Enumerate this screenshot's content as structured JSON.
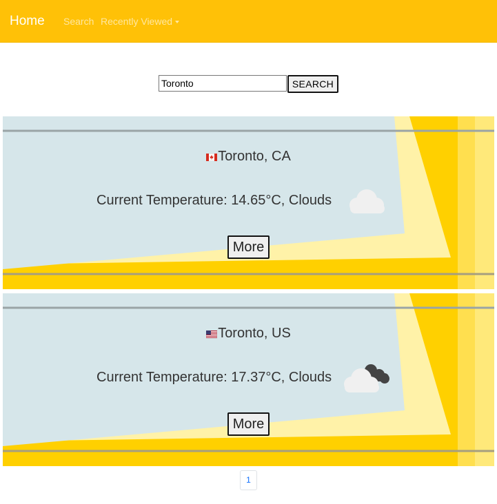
{
  "navbar": {
    "brand": "Home",
    "links": [
      "Search",
      "Recently Viewed"
    ],
    "dropdown_caret_icon": "caret-down-icon",
    "color": "#ffc107"
  },
  "search": {
    "value": "Toronto",
    "button_label": "SEARCH"
  },
  "results": [
    {
      "location": "Toronto, CA",
      "flag_icon": "flag-canada-icon",
      "temperature_text": "Current Temperature: 14.65°C, Clouds",
      "weather_icon": "cloud-icon",
      "more_label": "More"
    },
    {
      "location": "Toronto, US",
      "flag_icon": "flag-usa-icon",
      "temperature_text": "Current Temperature: 17.37°C, Clouds",
      "weather_icon": "broken-clouds-icon",
      "more_label": "More"
    }
  ],
  "pagination": {
    "current_page": "1"
  },
  "colors": {
    "card_background": "#d6e6ea",
    "stripe_yellow": "#ffd000",
    "stripe_line": "#9aa4a6"
  }
}
